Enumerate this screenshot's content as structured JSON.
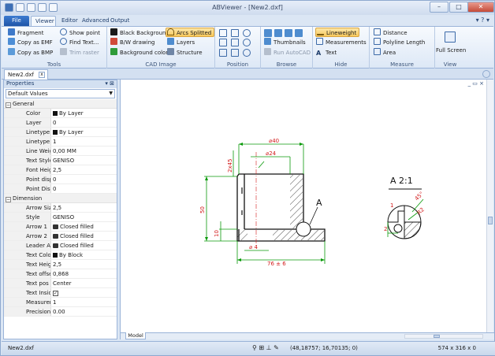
{
  "window": {
    "title": "ABViewer - [New2.dxf]",
    "buttons": {
      "minimize": "–",
      "maximize": "□",
      "close": "✕"
    }
  },
  "ribbon_tabs": [
    "File",
    "Viewer",
    "Editor",
    "Advanced",
    "Output"
  ],
  "ribbon_tabs_active": "Viewer",
  "ribbon_right": "▾ ? ▾",
  "groups": {
    "tools": {
      "label": "Tools",
      "items": [
        "Fragment",
        "Copy as EMF",
        "Copy as BMP",
        "Show point",
        "Find Text...",
        "Trim raster"
      ]
    },
    "cad_image": {
      "label": "CAD Image",
      "items": [
        "Black Background",
        "B/W drawing",
        "Background color",
        "Arcs Splitted",
        "Layers",
        "Structure"
      ]
    },
    "position": {
      "label": "Position"
    },
    "browse": {
      "label": "Browse",
      "items": [
        "Thumbnails",
        "Run AutoCAD"
      ]
    },
    "hide": {
      "label": "Hide",
      "items": [
        "Lineweight",
        "Measurements",
        "Text"
      ]
    },
    "measure": {
      "label": "Measure",
      "items": [
        "Distance",
        "Polyline Length",
        "Area"
      ]
    },
    "view": {
      "label": "View",
      "items": [
        "Full Screen"
      ]
    }
  },
  "doc_tab": {
    "name": "New2.dxf",
    "close": "x"
  },
  "properties": {
    "title": "Properties",
    "pin": "▾ ⊠",
    "dropdown": "Default Values",
    "general": {
      "label": "General",
      "rows": [
        [
          "Color",
          "By Layer"
        ],
        [
          "Layer",
          "0"
        ],
        [
          "Linetype",
          "By Layer"
        ],
        [
          "Linetype sc",
          "1"
        ],
        [
          "Line Weight",
          "0,00 MM"
        ],
        [
          "Text Style",
          "GENISO"
        ],
        [
          "Font Height",
          "2,5"
        ],
        [
          "Point displa",
          "0"
        ],
        [
          "Point Displa",
          "0"
        ]
      ]
    },
    "dimension": {
      "label": "Dimension",
      "rows": [
        [
          "Arrow Size",
          "2,5"
        ],
        [
          "Style",
          "GENISO"
        ],
        [
          "Arrow 1",
          "Closed filled"
        ],
        [
          "Arrow 2",
          "Closed filled"
        ],
        [
          "Leader Arro",
          "Closed filled"
        ],
        [
          "Text Color",
          "By Block"
        ],
        [
          "Text Height",
          "2,5"
        ],
        [
          "Text offset",
          "0,868"
        ],
        [
          "Text pos ve",
          "Center"
        ],
        [
          "Text Inside",
          "✓"
        ],
        [
          "Measuremen",
          "1"
        ],
        [
          "Precision",
          "0.00"
        ]
      ]
    }
  },
  "drawing": {
    "dims": {
      "d40": "⌀40",
      "d24": "⌀24",
      "chamfer": "2x45",
      "h50": "50",
      "h10": "10",
      "d4": "⌀ 4",
      "w76": "76 ± 6",
      "label_a": "A",
      "detail": "A  2:1",
      "r2": "R2",
      "d_1": "1",
      "d_2": "2",
      "angle": "45°"
    }
  },
  "model_tab": "Model",
  "status": {
    "file": "New2.dxf",
    "icons": "⚲ ⊞ ⊥ ✎",
    "coords": "(48,18757; 16,70135; 0)",
    "size": "574 x 316 x 0"
  },
  "colors": {
    "drawing_green": "#0a9a0a",
    "dim_red": "#d21b1b",
    "outline": "#111111",
    "ribbon_bg": "#dde8f6"
  }
}
